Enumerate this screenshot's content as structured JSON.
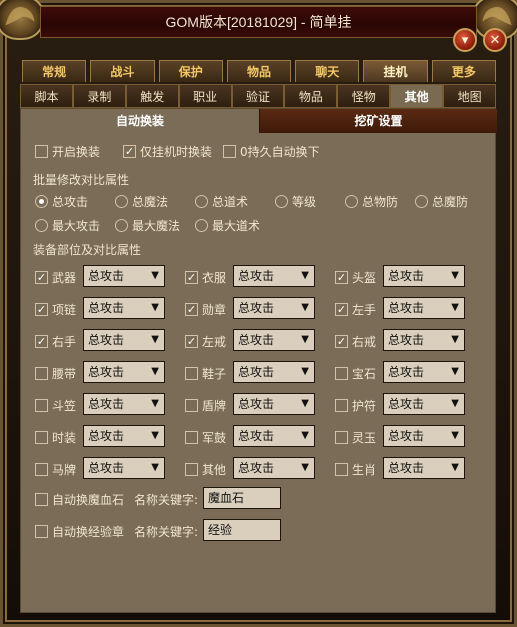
{
  "window": {
    "title": "GOM版本[20181029] - 简单挂",
    "min_icon": "chevron-down-icon",
    "close_icon": "close-icon"
  },
  "tabs_top": [
    {
      "label": "常规",
      "active": false
    },
    {
      "label": "战斗",
      "active": false
    },
    {
      "label": "保护",
      "active": false
    },
    {
      "label": "物品",
      "active": false
    },
    {
      "label": "聊天",
      "active": false
    },
    {
      "label": "挂机",
      "active": true
    },
    {
      "label": "更多",
      "active": false
    }
  ],
  "tabs_second": [
    {
      "label": "脚本",
      "active": false
    },
    {
      "label": "录制",
      "active": false
    },
    {
      "label": "触发",
      "active": false
    },
    {
      "label": "职业",
      "active": false
    },
    {
      "label": "验证",
      "active": false
    },
    {
      "label": "物品",
      "active": false
    },
    {
      "label": "怪物",
      "active": false
    },
    {
      "label": "其他",
      "active": true
    },
    {
      "label": "地图",
      "active": false
    }
  ],
  "subtabs": {
    "auto_equip": "自动换装",
    "mining": "挖矿设置"
  },
  "options": {
    "enable_swap": {
      "label": "开启换装",
      "checked": false
    },
    "only_when_idle": {
      "label": "仅挂机时换装",
      "checked": true
    },
    "zero_durability": {
      "label": "0持久自动换下",
      "checked": false
    }
  },
  "compare_section": {
    "title": "批量修改对比属性",
    "radios": [
      {
        "label": "总攻击",
        "selected": true
      },
      {
        "label": "总魔法",
        "selected": false
      },
      {
        "label": "总道术",
        "selected": false
      },
      {
        "label": "等级",
        "selected": false
      },
      {
        "label": "总物防",
        "selected": false
      },
      {
        "label": "总魔防",
        "selected": false
      },
      {
        "label": "最大攻击",
        "selected": false
      },
      {
        "label": "最大魔法",
        "selected": false
      },
      {
        "label": "最大道术",
        "selected": false
      }
    ]
  },
  "equip_section": {
    "title": "装备部位及对比属性",
    "slots": [
      {
        "label": "武器",
        "checked": true,
        "value": "总攻击"
      },
      {
        "label": "衣服",
        "checked": true,
        "value": "总攻击"
      },
      {
        "label": "头盔",
        "checked": true,
        "value": "总攻击"
      },
      {
        "label": "项链",
        "checked": true,
        "value": "总攻击"
      },
      {
        "label": "勋章",
        "checked": true,
        "value": "总攻击"
      },
      {
        "label": "左手",
        "checked": true,
        "value": "总攻击"
      },
      {
        "label": "右手",
        "checked": true,
        "value": "总攻击"
      },
      {
        "label": "左戒",
        "checked": true,
        "value": "总攻击"
      },
      {
        "label": "右戒",
        "checked": true,
        "value": "总攻击"
      },
      {
        "label": "腰带",
        "checked": false,
        "value": "总攻击"
      },
      {
        "label": "鞋子",
        "checked": false,
        "value": "总攻击"
      },
      {
        "label": "宝石",
        "checked": false,
        "value": "总攻击"
      },
      {
        "label": "斗笠",
        "checked": false,
        "value": "总攻击"
      },
      {
        "label": "盾牌",
        "checked": false,
        "value": "总攻击"
      },
      {
        "label": "护符",
        "checked": false,
        "value": "总攻击"
      },
      {
        "label": "时装",
        "checked": false,
        "value": "总攻击"
      },
      {
        "label": "军鼓",
        "checked": false,
        "value": "总攻击"
      },
      {
        "label": "灵玉",
        "checked": false,
        "value": "总攻击"
      },
      {
        "label": "马牌",
        "checked": false,
        "value": "总攻击"
      },
      {
        "label": "其他",
        "checked": false,
        "value": "总攻击"
      },
      {
        "label": "生肖",
        "checked": false,
        "value": "总攻击"
      }
    ]
  },
  "auto_items": [
    {
      "label": "自动换魔血石",
      "checked": false,
      "key_label": "名称关键字:",
      "value": "魔血石"
    },
    {
      "label": "自动换经验章",
      "checked": false,
      "key_label": "名称关键字:",
      "value": "经验"
    }
  ]
}
